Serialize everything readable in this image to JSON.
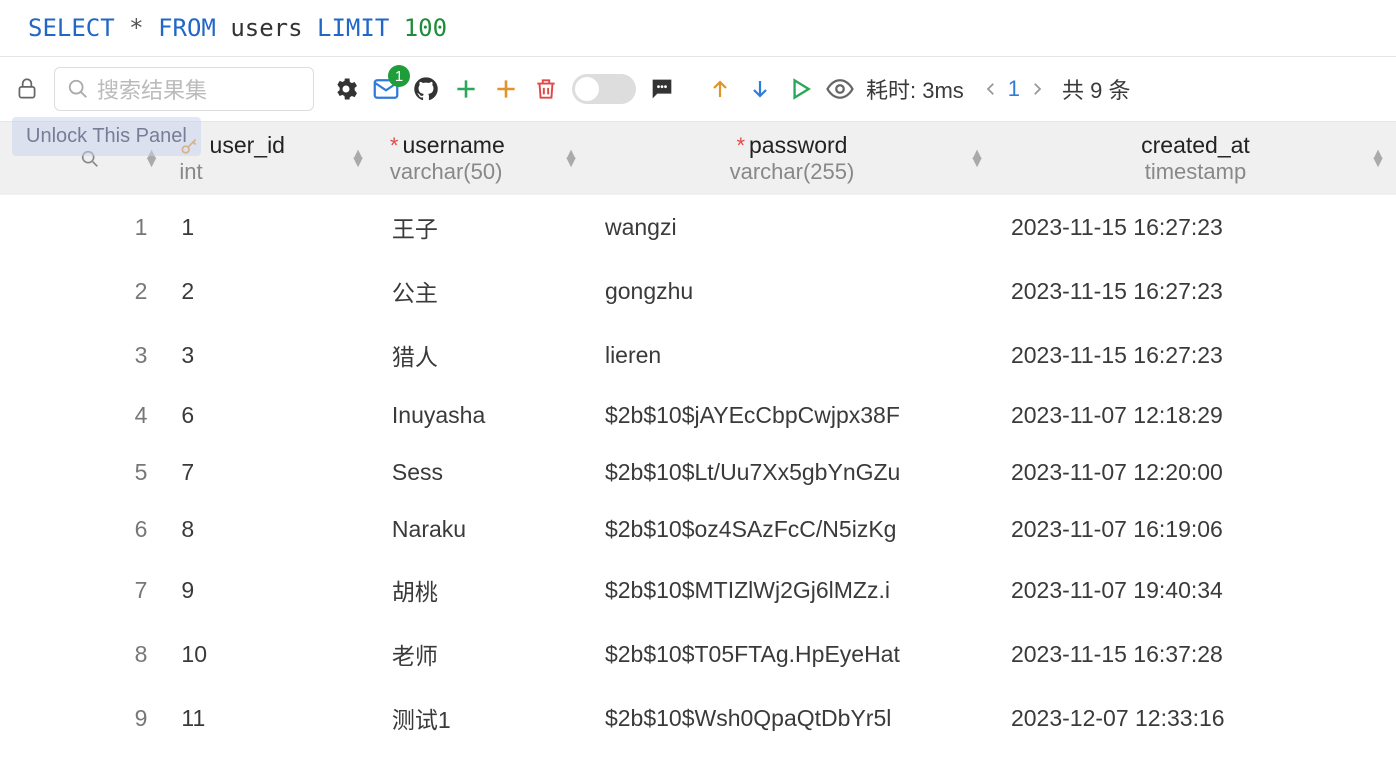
{
  "sql": {
    "select": "SELECT",
    "star": "*",
    "from": "FROM",
    "table": "users",
    "limit": "LIMIT",
    "n": "100"
  },
  "toolbar": {
    "search_placeholder": "搜索结果集",
    "mail_badge": "1",
    "timing_label": "耗时: 3ms",
    "page": "1",
    "total": "共 9 条",
    "tooltip": "Unlock This Panel"
  },
  "columns": [
    {
      "name": "user_id",
      "type": "int",
      "key": true,
      "required": false
    },
    {
      "name": "username",
      "type": "varchar(50)",
      "key": false,
      "required": true
    },
    {
      "name": "password",
      "type": "varchar(255)",
      "key": false,
      "required": true
    },
    {
      "name": "created_at",
      "type": "timestamp",
      "key": false,
      "required": false
    }
  ],
  "rows": [
    {
      "n": "1",
      "user_id": "1",
      "username": "王子",
      "password": "wangzi",
      "created_at": "2023-11-15 16:27:23"
    },
    {
      "n": "2",
      "user_id": "2",
      "username": "公主",
      "password": "gongzhu",
      "created_at": "2023-11-15 16:27:23"
    },
    {
      "n": "3",
      "user_id": "3",
      "username": "猎人",
      "password": "lieren",
      "created_at": "2023-11-15 16:27:23"
    },
    {
      "n": "4",
      "user_id": "6",
      "username": "Inuyasha",
      "password": "$2b$10$jAYEcCbpCwjpx38F",
      "created_at": "2023-11-07 12:18:29"
    },
    {
      "n": "5",
      "user_id": "7",
      "username": "Sess",
      "password": "$2b$10$Lt/Uu7Xx5gbYnGZu",
      "created_at": "2023-11-07 12:20:00"
    },
    {
      "n": "6",
      "user_id": "8",
      "username": "Naraku",
      "password": "$2b$10$oz4SAzFcC/N5izKg",
      "created_at": "2023-11-07 16:19:06"
    },
    {
      "n": "7",
      "user_id": "9",
      "username": "胡桃",
      "password": "$2b$10$MTIZlWj2Gj6lMZz.i",
      "created_at": "2023-11-07 19:40:34"
    },
    {
      "n": "8",
      "user_id": "10",
      "username": "老师",
      "password": "$2b$10$T05FTAg.HpEyeHat",
      "created_at": "2023-11-15 16:37:28"
    },
    {
      "n": "9",
      "user_id": "11",
      "username": "测试1",
      "password": "$2b$10$Wsh0QpaQtDbYr5l",
      "created_at": "2023-12-07 12:33:16"
    }
  ]
}
